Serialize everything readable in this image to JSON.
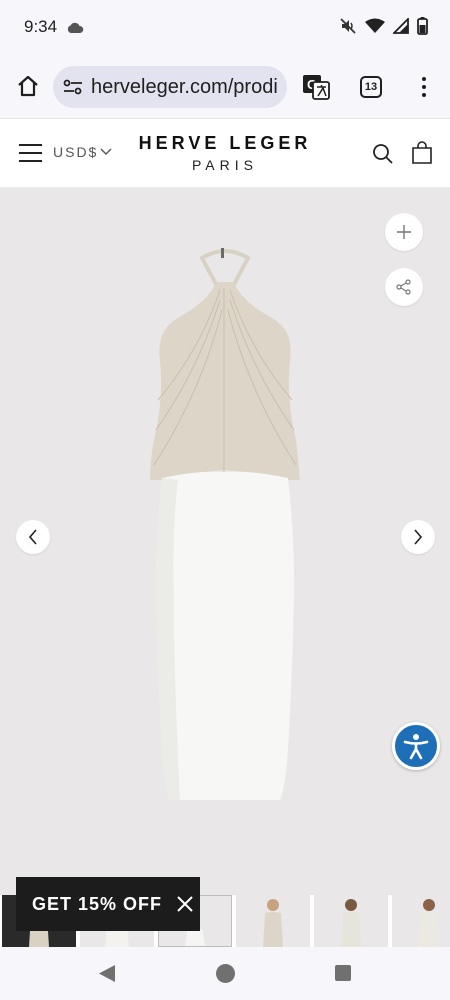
{
  "status": {
    "time": "9:34",
    "icons": [
      "cloud-icon",
      "mute-icon",
      "wifi-icon",
      "signal-icon",
      "battery-icon"
    ]
  },
  "browser": {
    "url": "herveleger.com/prodi",
    "tab_count": "13",
    "icons": [
      "home-icon",
      "site-settings-icon",
      "translate-icon",
      "more-vert-icon"
    ]
  },
  "header": {
    "currency": "USD$",
    "brand_name": "HERVE LEGER",
    "brand_sub": "PARIS",
    "icons": [
      "menu-icon",
      "chevron-down-icon",
      "search-icon",
      "shopping-bag-icon"
    ]
  },
  "gallery": {
    "icons": [
      "plus-icon",
      "share-icon",
      "chevron-left-icon",
      "chevron-right-icon",
      "accessibility-icon"
    ],
    "colors": {
      "background": "#e9e7e7",
      "dress_top": "#ddd6c8",
      "dress_skirt": "#f7f7f5",
      "accessibility": "#1e6fb8"
    }
  },
  "promo": {
    "label": "GET 15% OFF"
  },
  "nav": {
    "icons": [
      "back-triangle-icon",
      "home-circle-icon",
      "recents-square-icon"
    ]
  }
}
